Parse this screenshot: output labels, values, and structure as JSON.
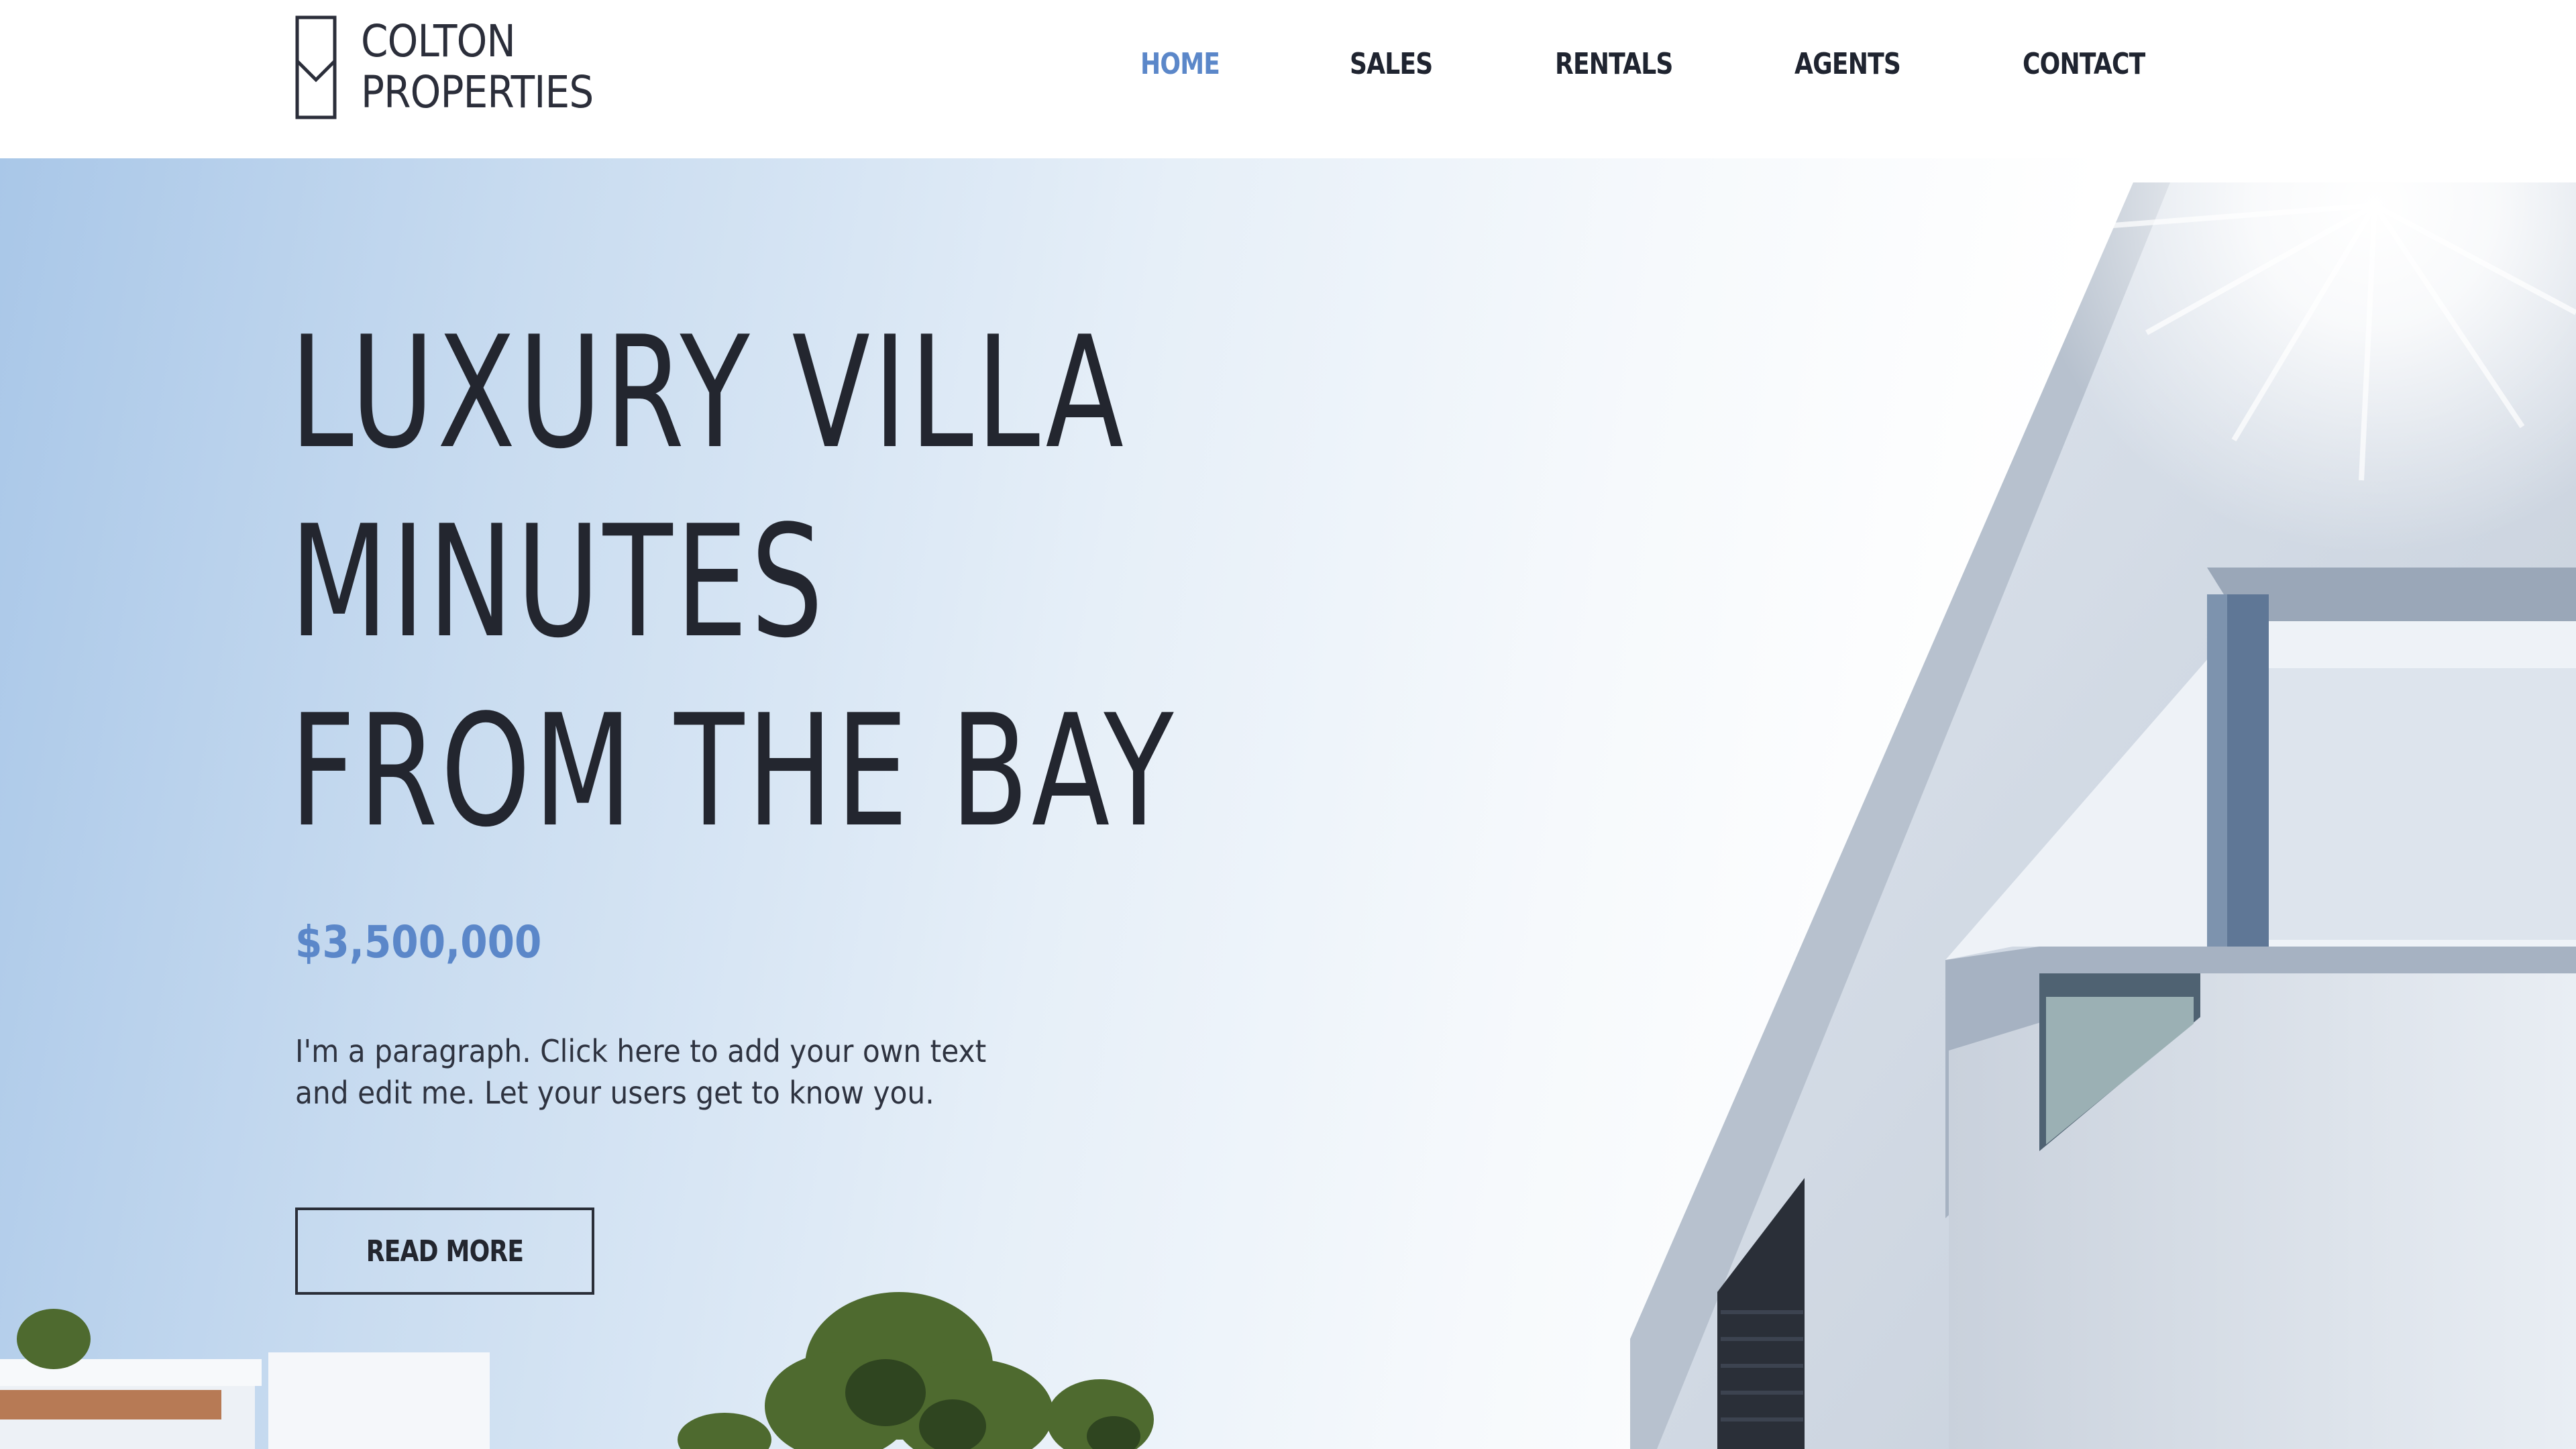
{
  "header": {
    "logo": {
      "line1": "COLTON",
      "line2": "PROPERTIES"
    },
    "nav": [
      {
        "label": "HOME",
        "active": true
      },
      {
        "label": "SALES",
        "active": false
      },
      {
        "label": "RENTALS",
        "active": false
      },
      {
        "label": "AGENTS",
        "active": false
      },
      {
        "label": "CONTACT",
        "active": false
      }
    ]
  },
  "hero": {
    "headline_lines": [
      "LUXURY VILLA",
      "MINUTES",
      "FROM THE BAY"
    ],
    "price": "$3,500,000",
    "paragraph": "I'm a paragraph. Click here to add your own text and edit me. Let your users get to know you.",
    "button_label": "READ MORE"
  },
  "colors": {
    "accent": "#5b87c9",
    "text_dark": "#23262f",
    "background": "#ffffff"
  }
}
